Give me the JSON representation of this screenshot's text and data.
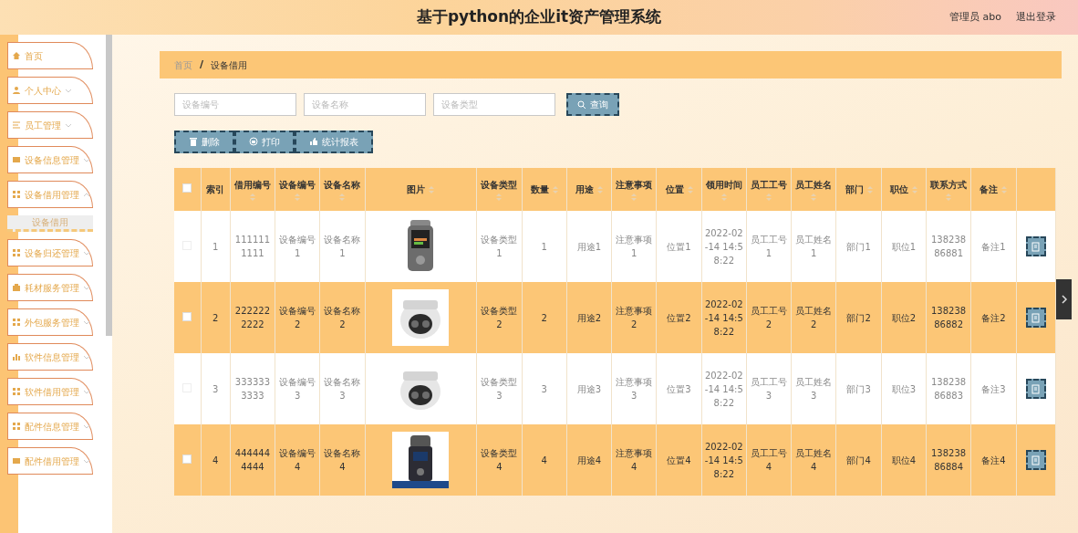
{
  "header": {
    "title": "基于python的企业it资产管理系统",
    "user": "管理员 abo",
    "logout": "退出登录"
  },
  "sidebar": {
    "items": [
      {
        "label": "首页",
        "expandable": false,
        "expanded": false
      },
      {
        "label": "个人中心",
        "expandable": true,
        "expanded": false
      },
      {
        "label": "员工管理",
        "expandable": true,
        "expanded": false
      },
      {
        "label": "设备信息管理",
        "expandable": true,
        "expanded": false
      },
      {
        "label": "设备借用管理",
        "expandable": true,
        "expanded": true,
        "children": [
          {
            "label": "设备借用",
            "selected": true
          }
        ]
      },
      {
        "label": "设备归还管理",
        "expandable": true,
        "expanded": false
      },
      {
        "label": "耗材服务管理",
        "expandable": true,
        "expanded": false
      },
      {
        "label": "外包服务管理",
        "expandable": true,
        "expanded": false
      },
      {
        "label": "软件信息管理",
        "expandable": true,
        "expanded": false
      },
      {
        "label": "软件借用管理",
        "expandable": true,
        "expanded": false
      },
      {
        "label": "配件信息管理",
        "expandable": true,
        "expanded": false
      },
      {
        "label": "配件借用管理",
        "expandable": true,
        "expanded": false
      }
    ]
  },
  "breadcrumb": {
    "separator": "/",
    "items": [
      "首页",
      "设备借用"
    ]
  },
  "search": {
    "fields": [
      {
        "placeholder": "设备编号"
      },
      {
        "placeholder": "设备名称"
      },
      {
        "placeholder": "设备类型"
      }
    ],
    "button": "查询"
  },
  "actions": [
    {
      "label": "删除",
      "kind": "trash"
    },
    {
      "label": "打印",
      "kind": "print"
    },
    {
      "label": "统计报表",
      "kind": "chart"
    }
  ],
  "table": {
    "all_checked": false,
    "columns": [
      {
        "label": "索引",
        "kind": "text",
        "sortable": false
      },
      {
        "label": "借用编号",
        "kind": "text",
        "sortable": true
      },
      {
        "label": "设备编号",
        "kind": "text",
        "sortable": true
      },
      {
        "label": "设备名称",
        "kind": "text",
        "sortable": true
      },
      {
        "label": "图片",
        "kind": "picture",
        "sortable": true
      },
      {
        "label": "设备类型",
        "kind": "text",
        "sortable": true
      },
      {
        "label": "数量",
        "kind": "text",
        "sortable": true
      },
      {
        "label": "用途",
        "kind": "text",
        "sortable": true
      },
      {
        "label": "注意事项",
        "kind": "text",
        "sortable": true
      },
      {
        "label": "位置",
        "kind": "text",
        "sortable": true
      },
      {
        "label": "领用时间",
        "kind": "text",
        "sortable": true
      },
      {
        "label": "员工工号",
        "kind": "text",
        "sortable": true
      },
      {
        "label": "员工姓名",
        "kind": "text",
        "sortable": true
      },
      {
        "label": "部门",
        "kind": "text",
        "sortable": true
      },
      {
        "label": "职位",
        "kind": "text",
        "sortable": true
      },
      {
        "label": "联系方式",
        "kind": "text",
        "sortable": true
      },
      {
        "label": "备注",
        "kind": "text",
        "sortable": true
      }
    ],
    "rows": [
      {
        "checked": false,
        "cells": [
          "1",
          "1111111111",
          "设备编号1",
          "设备名称1",
          "",
          "设备类型1",
          "1",
          "用途1",
          "注意事项1",
          "位置1",
          "2022-02-14 14:58:22",
          "员工工号1",
          "员工姓名1",
          "部门1",
          "职位1",
          "13823886881",
          "备注1"
        ]
      },
      {
        "checked": false,
        "cells": [
          "2",
          "2222222222",
          "设备编号2",
          "设备名称2",
          "",
          "设备类型2",
          "2",
          "用途2",
          "注意事项2",
          "位置2",
          "2022-02-14 14:58:22",
          "员工工号2",
          "员工姓名2",
          "部门2",
          "职位2",
          "13823886882",
          "备注2"
        ]
      },
      {
        "checked": false,
        "cells": [
          "3",
          "3333333333",
          "设备编号3",
          "设备名称3",
          "",
          "设备类型3",
          "3",
          "用途3",
          "注意事项3",
          "位置3",
          "2022-02-14 14:58:22",
          "员工工号3",
          "员工姓名3",
          "部门3",
          "职位3",
          "13823886883",
          "备注3"
        ]
      },
      {
        "checked": false,
        "cells": [
          "4",
          "4444444444",
          "设备编号4",
          "设备名称4",
          "",
          "设备类型4",
          "4",
          "用途4",
          "注意事项4",
          "位置4",
          "2022-02-14 14:58:22",
          "员工工号4",
          "员工姓名4",
          "部门4",
          "职位4",
          "13823886884",
          "备注4"
        ]
      }
    ]
  }
}
